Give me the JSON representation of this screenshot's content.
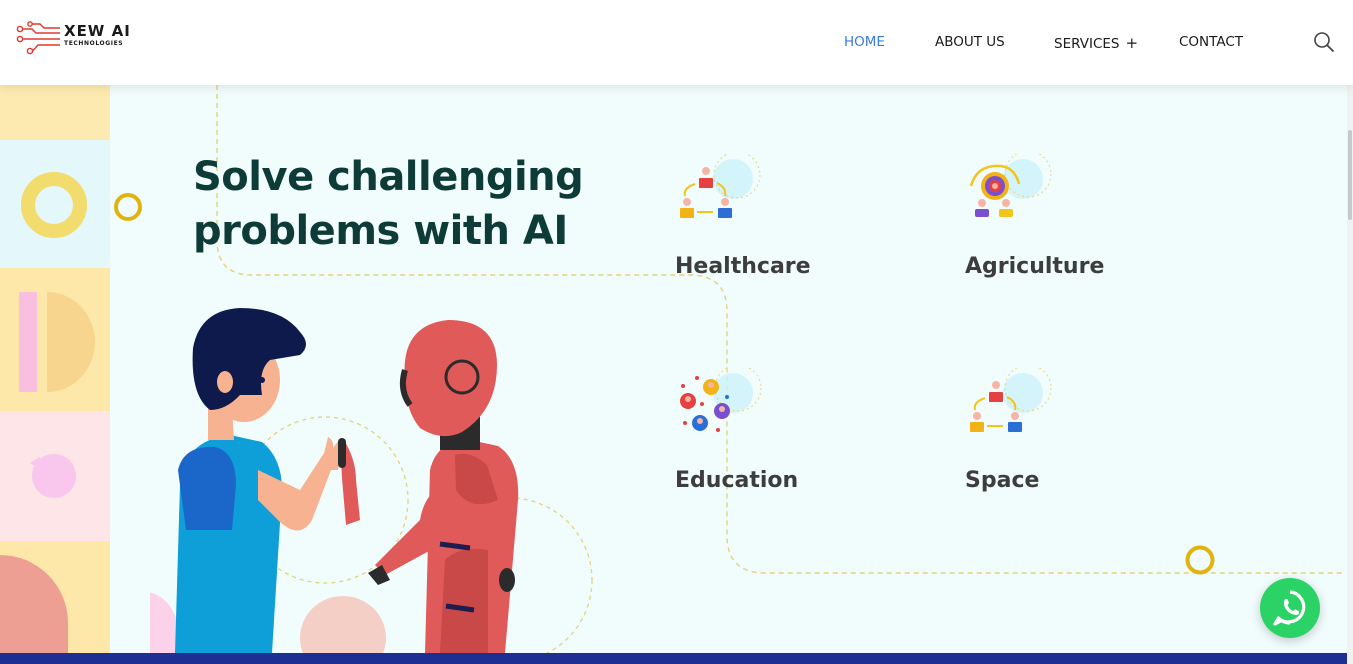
{
  "header": {
    "logo": {
      "name": "XEW AI",
      "sub": "TECHNOLOGIES"
    },
    "nav": [
      {
        "label": "HOME",
        "active": true
      },
      {
        "label": "ABOUT US",
        "active": false
      },
      {
        "label": "SERVICES",
        "active": false,
        "has_submenu": true
      },
      {
        "label": "CONTACT",
        "active": false
      }
    ],
    "services_plus": "+",
    "search_icon": "search-icon"
  },
  "hero": {
    "headline_line1": "Solve challenging",
    "headline_line2": "problems with AI"
  },
  "categories": [
    {
      "label": "Healthcare",
      "icon": "healthcare-icon"
    },
    {
      "label": "Agriculture",
      "icon": "agriculture-icon"
    },
    {
      "label": "Education",
      "icon": "education-icon"
    },
    {
      "label": "Space",
      "icon": "space-icon"
    }
  ],
  "colors": {
    "accent": "#3a7be0",
    "headline": "#0c3b38",
    "background": "#f1fcfc",
    "footer_bar": "#1d2f93",
    "whatsapp": "#2bd366",
    "ring": "#e0b40f"
  },
  "floating": {
    "whatsapp_icon": "whatsapp-icon"
  }
}
